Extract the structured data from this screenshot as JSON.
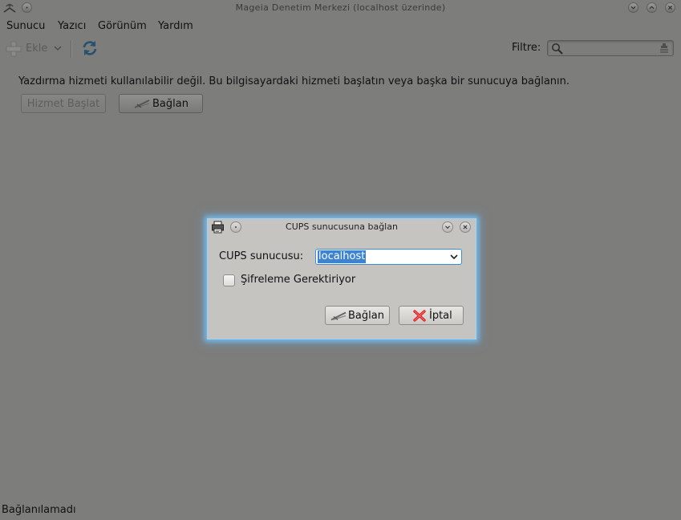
{
  "window": {
    "title": "Mageia Denetim Merkezi  (localhost üzerinde)"
  },
  "menubar": {
    "items": [
      {
        "label": "Sunucu"
      },
      {
        "label": "Yazıcı"
      },
      {
        "label": "Görünüm"
      },
      {
        "label": "Yardım"
      }
    ]
  },
  "toolbar": {
    "add_label": "Ekle",
    "filter_label": "Filtre:",
    "filter_value": ""
  },
  "main": {
    "message": "Yazdırma hizmeti kullanılabilir değil. Bu bilgisayardaki hizmeti başlatın veya başka bir sunucuya bağlanın.",
    "start_service_label": "Hizmet Başlat",
    "connect_label": "Bağlan"
  },
  "statusbar": {
    "text": "Bağlanılamadı"
  },
  "dialog": {
    "title": "CUPS sunucusuna bağlan",
    "server_label": "CUPS sunucusu:",
    "server_value": "localhost",
    "encryption_label": "Şifreleme Gerektiriyor",
    "encryption_checked": false,
    "connect_label": "Bağlan",
    "cancel_label": "İptal"
  },
  "colors": {
    "background": "#7d7d7b",
    "dialog_background": "#c6c4c1",
    "focus_glow": "#78c8ff",
    "selection": "#3d83cf",
    "cancel_red": "#d8242a"
  }
}
